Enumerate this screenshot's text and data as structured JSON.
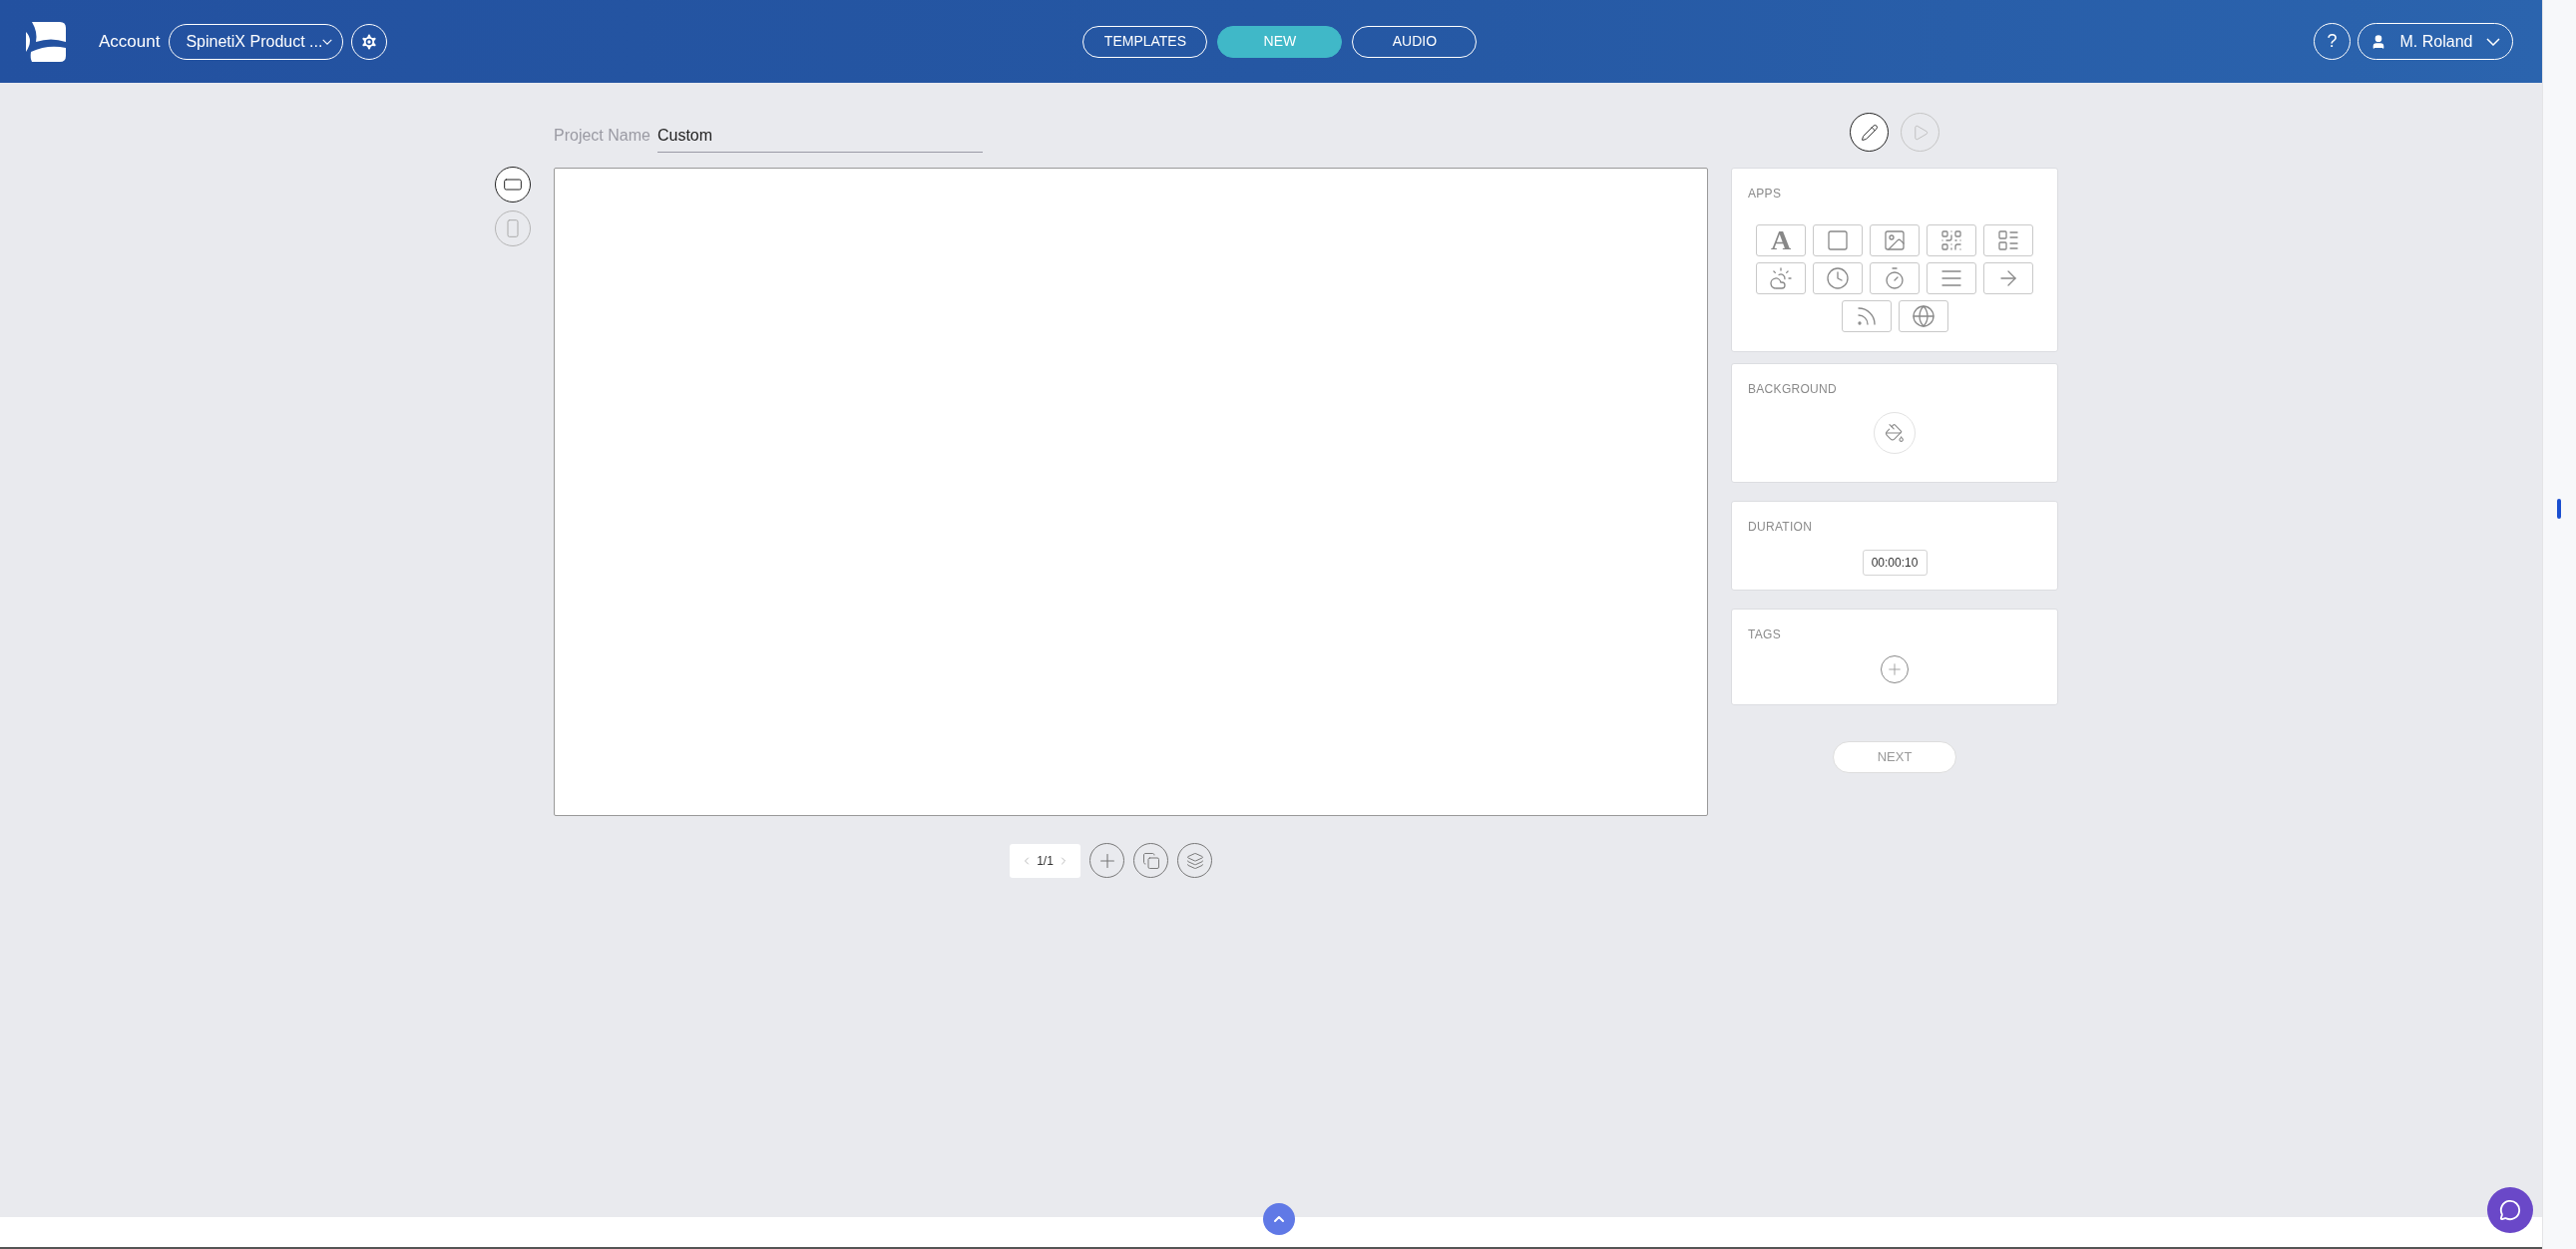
{
  "header": {
    "account_label": "Account",
    "account_select": "SpinetiX Product ...",
    "help": "?",
    "user": "M. Roland",
    "tabs": [
      {
        "label": "TEMPLATES",
        "selected": false
      },
      {
        "label": "NEW",
        "selected": true
      },
      {
        "label": "AUDIO",
        "selected": false
      }
    ]
  },
  "project_name": {
    "label": "Project Name",
    "value": "Custom"
  },
  "orientations": [
    {
      "kind": "landscape",
      "selected": true
    },
    {
      "kind": "portrait",
      "selected": false
    }
  ],
  "modes": [
    {
      "kind": "edit",
      "selected": true
    },
    {
      "kind": "preview",
      "selected": false
    }
  ],
  "apps": {
    "title": "APPS",
    "items": [
      {
        "kind": "text",
        "glyph": "A"
      },
      {
        "kind": "shape"
      },
      {
        "kind": "image"
      },
      {
        "kind": "qr"
      },
      {
        "kind": "table"
      },
      {
        "kind": "weather"
      },
      {
        "kind": "clock"
      },
      {
        "kind": "timer"
      },
      {
        "kind": "list"
      },
      {
        "kind": "arrow"
      },
      {
        "kind": "rss"
      },
      {
        "kind": "web"
      }
    ]
  },
  "background": {
    "title": "BACKGROUND"
  },
  "duration": {
    "title": "DURATION",
    "value": "00:00:10"
  },
  "tags": {
    "title": "TAGS"
  },
  "next": "NEXT",
  "pagination": {
    "page": "1/1"
  }
}
